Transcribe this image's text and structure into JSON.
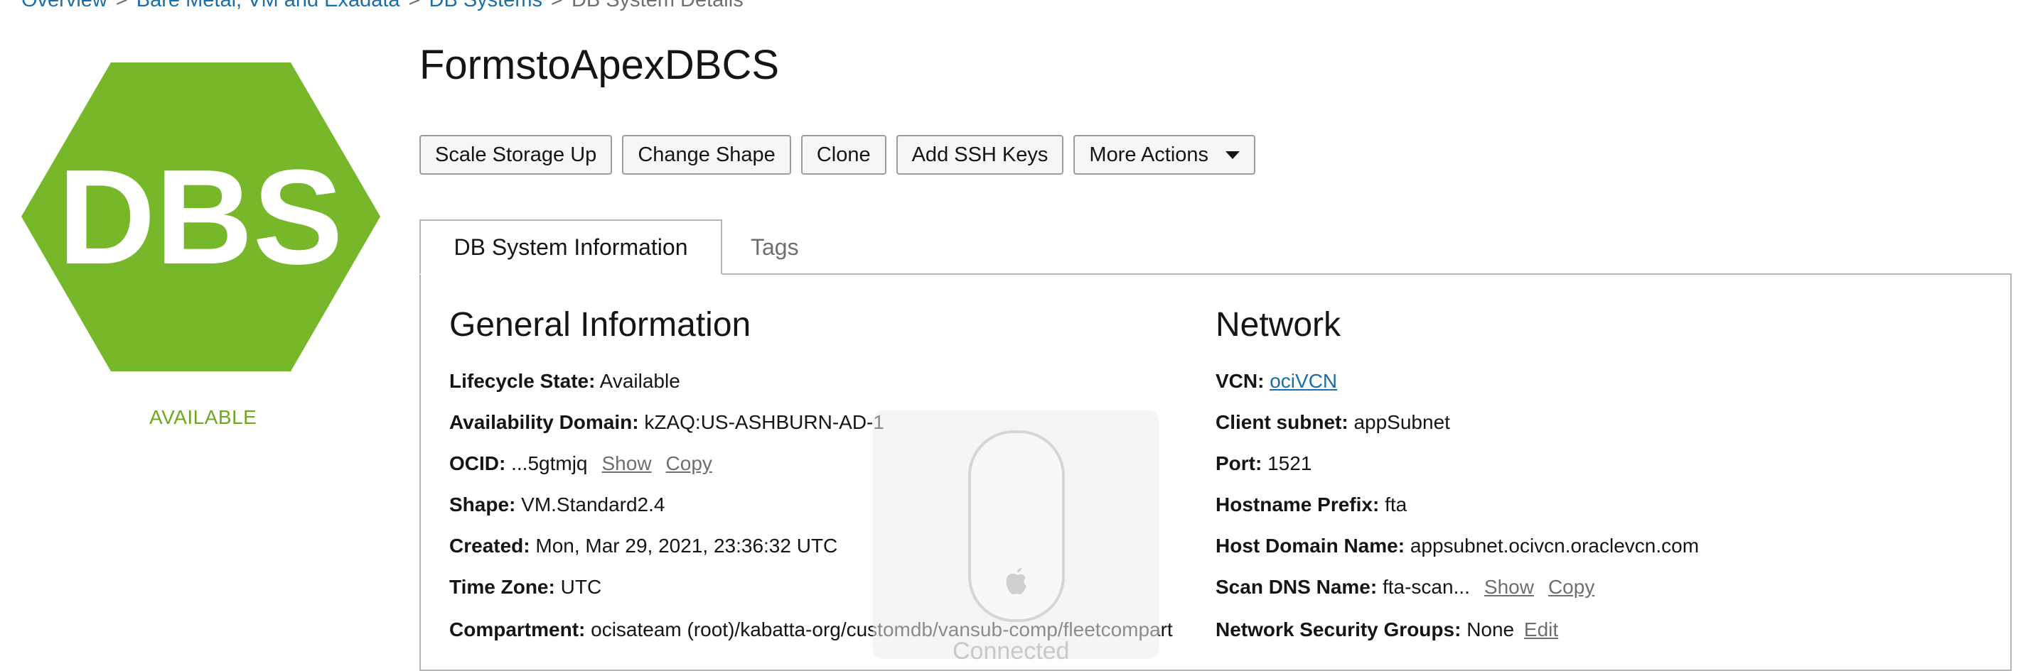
{
  "breadcrumb": {
    "items": [
      "Overview",
      "Bare Metal, VM and Exadata",
      "DB Systems"
    ],
    "current": "DB System Details",
    "separator": ">"
  },
  "logo": {
    "text": "DBS",
    "color": "#76b82a",
    "icon": "dbs-hexagon-icon"
  },
  "status": {
    "label": "AVAILABLE",
    "color": "#6fa820"
  },
  "page": {
    "title": "FormstoApexDBCS"
  },
  "toolbar": {
    "scale_storage_up": "Scale Storage Up",
    "change_shape": "Change Shape",
    "clone": "Clone",
    "add_ssh_keys": "Add SSH Keys",
    "more_actions": "More Actions"
  },
  "tabs": [
    {
      "label": "DB System Information",
      "active": true
    },
    {
      "label": "Tags",
      "active": false
    }
  ],
  "general": {
    "title": "General Information",
    "lifecycle_label": "Lifecycle State:",
    "lifecycle_value": "Available",
    "ad_label": "Availability Domain:",
    "ad_value": "kZAQ:US-ASHBURN-AD-1",
    "ocid_label": "OCID:",
    "ocid_value": "...5gtmjq",
    "show": "Show",
    "copy": "Copy",
    "shape_label": "Shape:",
    "shape_value": "VM.Standard2.4",
    "created_label": "Created:",
    "created_value": "Mon, Mar 29, 2021, 23:36:32 UTC",
    "tz_label": "Time Zone:",
    "tz_value": "UTC",
    "compartment_label": "Compartment:",
    "compartment_value": "ocisateam (root)/kabatta-org/customdb/vansub-comp/fleetcompart"
  },
  "network": {
    "title": "Network",
    "vcn_label": "VCN:",
    "vcn_value": "ociVCN",
    "subnet_label": "Client subnet:",
    "subnet_value": "appSubnet",
    "port_label": "Port:",
    "port_value": "1521",
    "hostname_label": "Hostname Prefix:",
    "hostname_value": "fta",
    "domain_label": "Host Domain Name:",
    "domain_value": "appsubnet.ocivcn.oraclevcn.com",
    "scan_label": "Scan DNS Name:",
    "scan_value": "fta-scan...",
    "show": "Show",
    "copy": "Copy",
    "nsg_label": "Network Security Groups:",
    "nsg_value": "None",
    "edit": "Edit"
  },
  "overlay": {
    "label": "Connected",
    "icon": "magic-mouse-icon"
  }
}
